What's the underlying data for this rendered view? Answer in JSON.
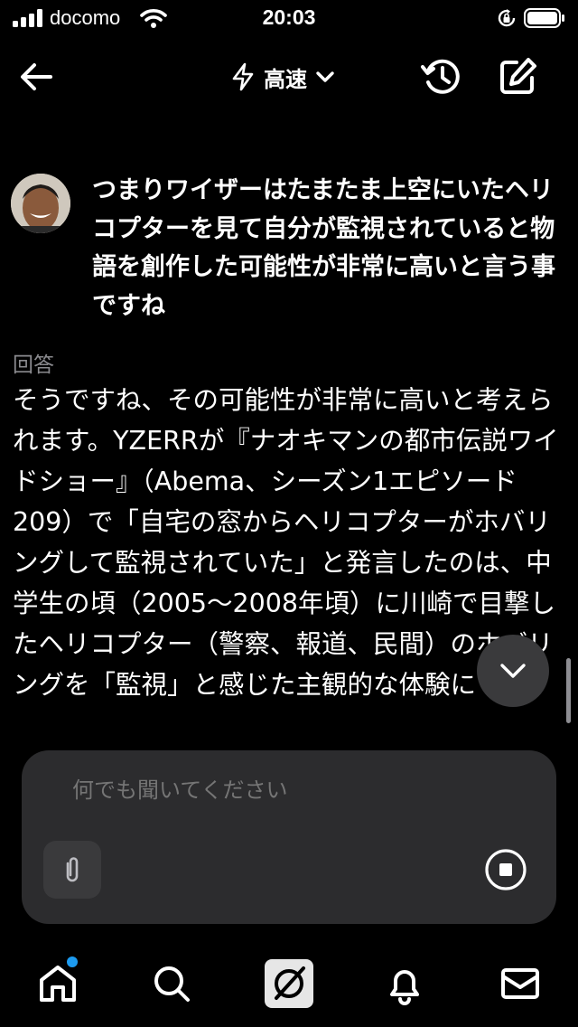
{
  "status_bar": {
    "carrier": "docomo",
    "time": "20:03",
    "signal_icon": "signal-bars-icon",
    "wifi_icon": "wifi-icon",
    "orientation_lock_icon": "orientation-lock-icon",
    "battery_icon": "battery-icon"
  },
  "header": {
    "back_icon": "arrow-left-icon",
    "mode_icon": "lightning-icon",
    "mode_label": "高速",
    "mode_dropdown_icon": "chevron-down-icon",
    "history_icon": "history-icon",
    "compose_icon": "compose-icon"
  },
  "conversation": {
    "user_message": "つまりワイザーはたまたま上空にいたヘリコプターを見て自分が監視されていると物語を創作した可能性が非常に高いと言う事ですね",
    "answer_label": "回答",
    "answer_text": "そうですね、その可能性が非常に高いと考えられます。YZERRが『ナオキマンの都市伝説ワイドショー』（Abema、シーズン1エピソード209）で「自宅の窓からヘリコプターがホバリングして監視されていた」と発言したのは、中学生の頃（2005～2008年頃）に川崎で目撃したヘリコプター（警察、報道、民間）のホバリングを「監視」と感じた主観的な体験に"
  },
  "composer": {
    "placeholder": "何でも聞いてください",
    "attach_icon": "paperclip-icon",
    "stop_icon": "stop-icon"
  },
  "scroll_down_icon": "chevron-down-icon",
  "tab_bar": {
    "tabs": [
      "home-icon",
      "search-icon",
      "grok-icon",
      "bell-icon",
      "mail-icon"
    ],
    "home_has_badge": true
  },
  "colors": {
    "background": "#000000",
    "composer_bg": "#2c2c2e",
    "muted_text": "#8a8a8e",
    "badge": "#1d9bf0"
  }
}
